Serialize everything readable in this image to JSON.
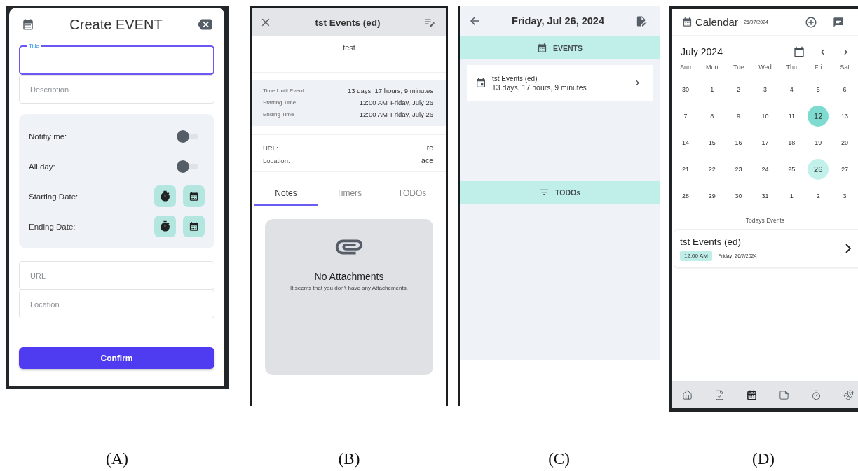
{
  "create_event": {
    "caption": "(A)",
    "title": "Create EVENT",
    "title_field": {
      "label": "Title"
    },
    "description_field": {
      "placeholder": "Description"
    },
    "settings": [
      {
        "kind": "toggle",
        "label": "Notifiy me:",
        "on": false
      },
      {
        "kind": "toggle",
        "label": "All day:",
        "on": false
      },
      {
        "kind": "picker",
        "label": "Starting Date:"
      },
      {
        "kind": "picker",
        "label": "Ending Date:"
      }
    ],
    "bottom_fields": [
      {
        "placeholder": "URL"
      },
      {
        "placeholder": "Location"
      }
    ],
    "confirm": "Confirm"
  },
  "event_details": {
    "caption": "(B)",
    "title": "tst Events (ed)",
    "description": "test",
    "times": [
      {
        "label": "Time Until Event",
        "time": "13 days, 17 hours, 9 minutes"
      },
      {
        "label": "Starting Time",
        "time": "12:00 AM",
        "date": "Friday, July 26"
      },
      {
        "label": "Ending Time",
        "time": "12:00 AM",
        "date": "Friday, July 26"
      }
    ],
    "links": [
      {
        "label": "URL:",
        "value": "re"
      },
      {
        "label": "Location:",
        "value": "ace"
      }
    ],
    "tabs": [
      {
        "label": "Notes",
        "selected": true
      },
      {
        "label": "Timers",
        "selected": false
      },
      {
        "label": "TODOs",
        "selected": false
      }
    ],
    "empty_state": {
      "title": "No Attachments",
      "message": "It seems that you don't have any Attachements."
    }
  },
  "day_view": {
    "caption": "(C)",
    "title": "Friday, Jul 26, 2024",
    "sections": [
      {
        "kind": "events",
        "label": "EVENTS",
        "items": [
          {
            "title": "tst Events (ed)",
            "subtitle": "13 days, 17 hours, 9 minutes"
          }
        ]
      },
      {
        "kind": "todos",
        "label": "TODOs"
      }
    ]
  },
  "calendar": {
    "caption": "(D)",
    "title": "Calendar",
    "date": "26/07/2024",
    "month": "July 2024",
    "weekdays": [
      "Sun",
      "Mon",
      "Tue",
      "Wed",
      "Thu",
      "Fri",
      "Sat"
    ],
    "weeks": [
      {
        "days": [
          {
            "day": "30",
            "today": false,
            "selected": false
          },
          {
            "day": "1",
            "today": false,
            "selected": false
          },
          {
            "day": "2",
            "today": false,
            "selected": false
          },
          {
            "day": "3",
            "today": false,
            "selected": false
          },
          {
            "day": "4",
            "today": false,
            "selected": false
          },
          {
            "day": "5",
            "today": false,
            "selected": false
          },
          {
            "day": "6",
            "today": false,
            "selected": false
          }
        ]
      },
      {
        "days": [
          {
            "day": "7",
            "today": false,
            "selected": false
          },
          {
            "day": "8",
            "today": false,
            "selected": false
          },
          {
            "day": "9",
            "today": false,
            "selected": false
          },
          {
            "day": "10",
            "today": false,
            "selected": false
          },
          {
            "day": "11",
            "today": false,
            "selected": false
          },
          {
            "day": "12",
            "today": true,
            "selected": false
          },
          {
            "day": "13",
            "today": false,
            "selected": false
          }
        ]
      },
      {
        "days": [
          {
            "day": "14",
            "today": false,
            "selected": false
          },
          {
            "day": "15",
            "today": false,
            "selected": false
          },
          {
            "day": "16",
            "today": false,
            "selected": false
          },
          {
            "day": "17",
            "today": false,
            "selected": false
          },
          {
            "day": "18",
            "today": false,
            "selected": false
          },
          {
            "day": "19",
            "today": false,
            "selected": false
          },
          {
            "day": "20",
            "today": false,
            "selected": false
          }
        ]
      },
      {
        "days": [
          {
            "day": "21",
            "today": false,
            "selected": false
          },
          {
            "day": "22",
            "today": false,
            "selected": false
          },
          {
            "day": "23",
            "today": false,
            "selected": false
          },
          {
            "day": "24",
            "today": false,
            "selected": false
          },
          {
            "day": "25",
            "today": false,
            "selected": false
          },
          {
            "day": "26",
            "today": false,
            "selected": true
          },
          {
            "day": "27",
            "today": false,
            "selected": false
          }
        ]
      },
      {
        "days": [
          {
            "day": "28",
            "today": false,
            "selected": false
          },
          {
            "day": "29",
            "today": false,
            "selected": false
          },
          {
            "day": "30",
            "today": false,
            "selected": false
          },
          {
            "day": "31",
            "today": false,
            "selected": false
          },
          {
            "day": "1",
            "today": false,
            "selected": false
          },
          {
            "day": "2",
            "today": false,
            "selected": false
          },
          {
            "day": "3",
            "today": false,
            "selected": false
          }
        ]
      }
    ],
    "todays_events": {
      "heading": "Todays Events",
      "items": [
        {
          "title": "tst Events (ed)",
          "time": "12:00 AM",
          "weekday": "Friday",
          "date": "26/7/2024"
        }
      ]
    },
    "nav": [
      {
        "kind": "home",
        "selected": false
      },
      {
        "kind": "tasks",
        "selected": false
      },
      {
        "kind": "calendar",
        "selected": true
      },
      {
        "kind": "notes",
        "selected": false
      },
      {
        "kind": "timer",
        "selected": false
      },
      {
        "kind": "masks",
        "selected": false
      }
    ]
  }
}
